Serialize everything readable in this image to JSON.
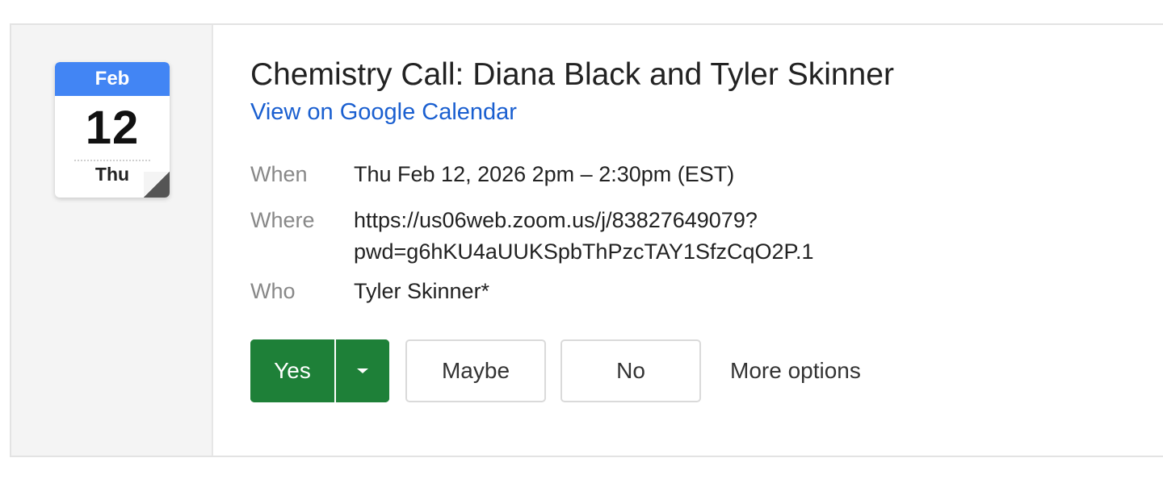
{
  "calendar_icon": {
    "month": "Feb",
    "day": "12",
    "weekday": "Thu"
  },
  "event": {
    "title": "Chemistry Call: Diana Black and Tyler Skinner",
    "calendar_link": "View on Google Calendar",
    "when_label": "When",
    "when_value": "Thu Feb 12, 2026 2pm – 2:30pm (EST)",
    "where_label": "Where",
    "where_line1": "https://us06web.zoom.us/j/83827649079?",
    "where_line2": "pwd=g6hKU4aUUKSpbThPzcTAY1SfzCqO2P.1",
    "who_label": "Who",
    "who_value": "Tyler Skinner*"
  },
  "rsvp": {
    "yes": "Yes",
    "maybe": "Maybe",
    "no": "No",
    "more_options": "More options"
  },
  "colors": {
    "accent_blue": "#4285f4",
    "link_blue": "#1a5fd0",
    "yes_green": "#1e8038"
  },
  "icons": {
    "dropdown": "chevron-down-icon",
    "calendar": "calendar-icon"
  }
}
